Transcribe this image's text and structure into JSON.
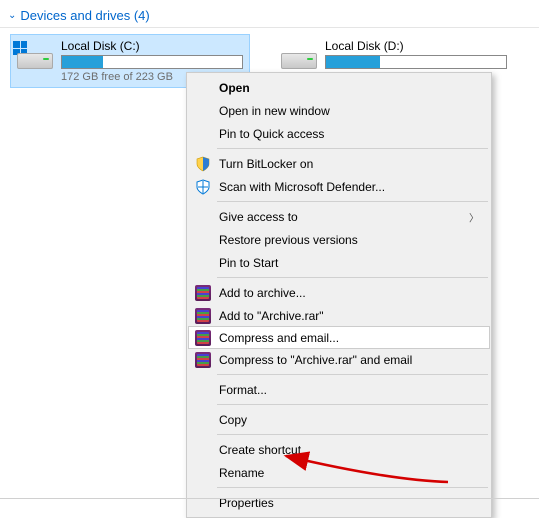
{
  "section": {
    "title": "Devices and drives (4)"
  },
  "drives": [
    {
      "name": "Local Disk (C:)",
      "free_text": "172 GB free of 223 GB",
      "fill_pct": 23,
      "selected": true,
      "has_win_logo": true
    },
    {
      "name": "Local Disk (D:)",
      "fill_pct": 30,
      "selected": false,
      "has_win_logo": false
    }
  ],
  "context_menu": {
    "items": [
      {
        "label": "Open",
        "bold": true
      },
      {
        "label": "Open in new window"
      },
      {
        "label": "Pin to Quick access"
      },
      {
        "sep": true
      },
      {
        "label": "Turn BitLocker on",
        "icon": "shield"
      },
      {
        "label": "Scan with Microsoft Defender...",
        "icon": "defender"
      },
      {
        "sep": true
      },
      {
        "label": "Give access to",
        "submenu": true
      },
      {
        "label": "Restore previous versions"
      },
      {
        "label": "Pin to Start"
      },
      {
        "sep": true
      },
      {
        "label": "Add to archive...",
        "icon": "rar"
      },
      {
        "label": "Add to \"Archive.rar\"",
        "icon": "rar"
      },
      {
        "label": "Compress and email...",
        "icon": "rar",
        "hover": true
      },
      {
        "label": "Compress to \"Archive.rar\" and email",
        "icon": "rar"
      },
      {
        "sep": true
      },
      {
        "label": "Format..."
      },
      {
        "sep": true
      },
      {
        "label": "Copy"
      },
      {
        "sep": true
      },
      {
        "label": "Create shortcut"
      },
      {
        "label": "Rename"
      },
      {
        "sep": true
      },
      {
        "label": "Properties"
      }
    ]
  },
  "annotation": {
    "color": "#d40000"
  }
}
